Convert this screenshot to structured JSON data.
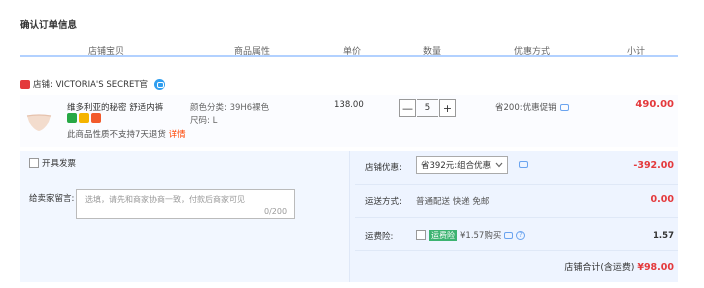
{
  "page_title": "确认订单信息",
  "table_headers": [
    "店铺宝贝",
    "商品属性",
    "单价",
    "数量",
    "优惠方式",
    "小计"
  ],
  "shop": {
    "label": "店铺: VICTORIA'S SECRET官"
  },
  "item": {
    "name": "维多利亚的秘密 舒适内裤",
    "sku_color": "颜色分类: 39H6裸色",
    "sku_size": "尺码: L",
    "notice": "此商品性质不支持7天退货",
    "notice_link": "详情",
    "unit_price": "138.00",
    "minus": "—",
    "quantity": "5",
    "plus": "+",
    "promo": "省200:优惠促销",
    "subtotal": "490.00"
  },
  "invoice": {
    "label": "开具发票"
  },
  "memo": {
    "label": "给卖家留言:",
    "placeholder": "选填，请先和商家协商一致，付款后商家可见",
    "count": "0/200"
  },
  "coupon": {
    "label": "店铺优惠:",
    "selected": "省392元:组合优惠",
    "value": "-392.00"
  },
  "shipping": {
    "label": "运送方式:",
    "method": "普通配送 快递 免邮",
    "value": "0.00"
  },
  "insurance": {
    "label": "运费险:",
    "tag": "运费险",
    "text": "¥1.57购买",
    "value": "1.57"
  },
  "shop_total": {
    "label": "店铺合计(含运费)",
    "amount": "¥98.00"
  },
  "colors": {
    "accent_red": "#e4393c",
    "header_line": "#b2d1ff",
    "panel_bg": "#eef4ff"
  }
}
